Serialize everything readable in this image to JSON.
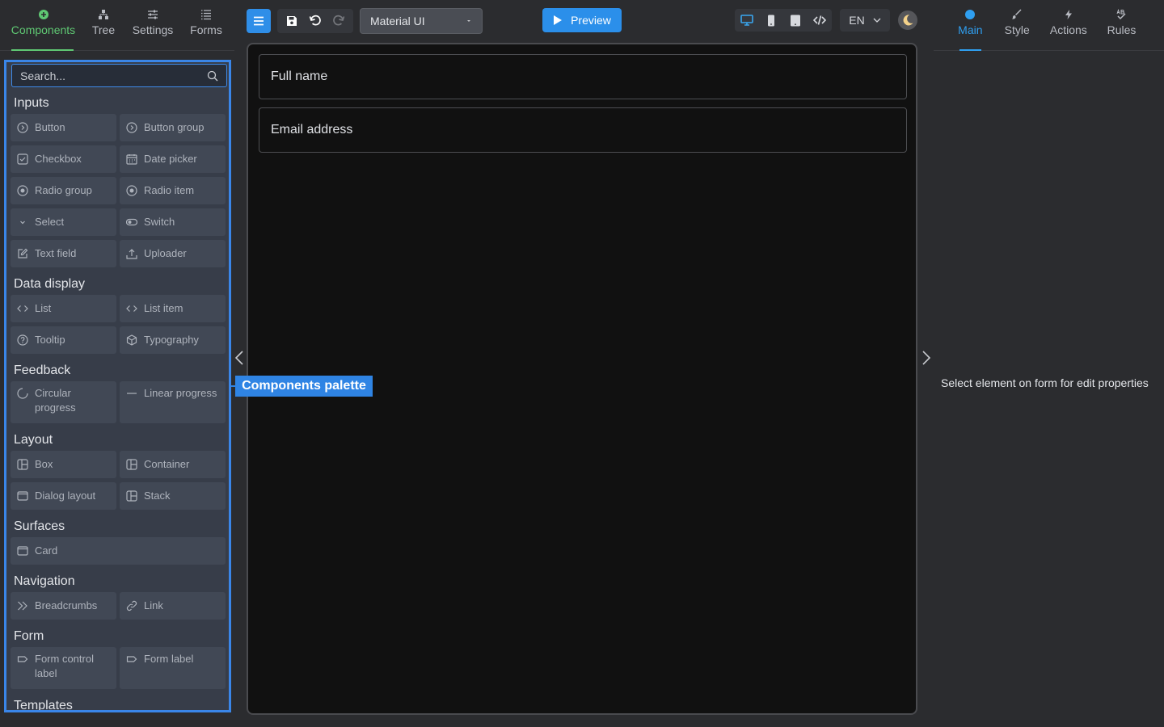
{
  "left_tabs": [
    {
      "label": "Components",
      "icon": "plus-circle-icon",
      "active": true
    },
    {
      "label": "Tree",
      "icon": "hierarchy-icon"
    },
    {
      "label": "Settings",
      "icon": "sliders-icon"
    },
    {
      "label": "Forms",
      "icon": "list-icon"
    }
  ],
  "search": {
    "placeholder": "Search..."
  },
  "groups": [
    {
      "title": "Inputs",
      "items": [
        {
          "label": "Button",
          "icon": "button-icon"
        },
        {
          "label": "Button group",
          "icon": "button-icon"
        },
        {
          "label": "Checkbox",
          "icon": "checkbox-icon"
        },
        {
          "label": "Date picker",
          "icon": "calendar-icon"
        },
        {
          "label": "Radio group",
          "icon": "radio-icon"
        },
        {
          "label": "Radio item",
          "icon": "radio-icon"
        },
        {
          "label": "Select",
          "icon": "chevron-down-icon"
        },
        {
          "label": "Switch",
          "icon": "toggle-icon"
        },
        {
          "label": "Text field",
          "icon": "edit-icon"
        },
        {
          "label": "Uploader",
          "icon": "upload-icon"
        }
      ]
    },
    {
      "title": "Data display",
      "items": [
        {
          "label": "List",
          "icon": "code-icon"
        },
        {
          "label": "List item",
          "icon": "code-icon"
        },
        {
          "label": "Tooltip",
          "icon": "help-icon"
        },
        {
          "label": "Typography",
          "icon": "cube-icon"
        }
      ]
    },
    {
      "title": "Feedback",
      "items": [
        {
          "label": "Circular progress",
          "icon": "spinner-icon"
        },
        {
          "label": "Linear progress",
          "icon": "line-icon"
        }
      ]
    },
    {
      "title": "Layout",
      "items": [
        {
          "label": "Box",
          "icon": "layout-icon"
        },
        {
          "label": "Container",
          "icon": "layout-icon"
        },
        {
          "label": "Dialog layout",
          "icon": "window-icon"
        },
        {
          "label": "Stack",
          "icon": "layout-icon"
        }
      ]
    },
    {
      "title": "Surfaces",
      "items": [
        {
          "label": "Card",
          "icon": "window-icon",
          "wide": true
        }
      ]
    },
    {
      "title": "Navigation",
      "items": [
        {
          "label": "Breadcrumbs",
          "icon": "double-chevron-icon"
        },
        {
          "label": "Link",
          "icon": "link-icon"
        }
      ]
    },
    {
      "title": "Form",
      "items": [
        {
          "label": "Form control label",
          "icon": "tag-icon"
        },
        {
          "label": "Form label",
          "icon": "tag-icon"
        }
      ]
    },
    {
      "title": "Templates",
      "items": []
    }
  ],
  "toolbar": {
    "library": "Material UI",
    "preview": "Preview",
    "language": "EN"
  },
  "canvas": {
    "fields": [
      "Full name",
      "Email address"
    ]
  },
  "callout": "Components palette",
  "right_tabs": [
    {
      "label": "Main",
      "icon": "dot-icon",
      "active": true
    },
    {
      "label": "Style",
      "icon": "brush-icon"
    },
    {
      "label": "Actions",
      "icon": "bolt-icon"
    },
    {
      "label": "Rules",
      "icon": "rules-icon"
    }
  ],
  "properties_hint": "Select element on form for edit properties",
  "colors": {
    "accent_green": "#5fc873",
    "accent_blue": "#2f9ff0",
    "palette_border": "#3a86e8"
  }
}
